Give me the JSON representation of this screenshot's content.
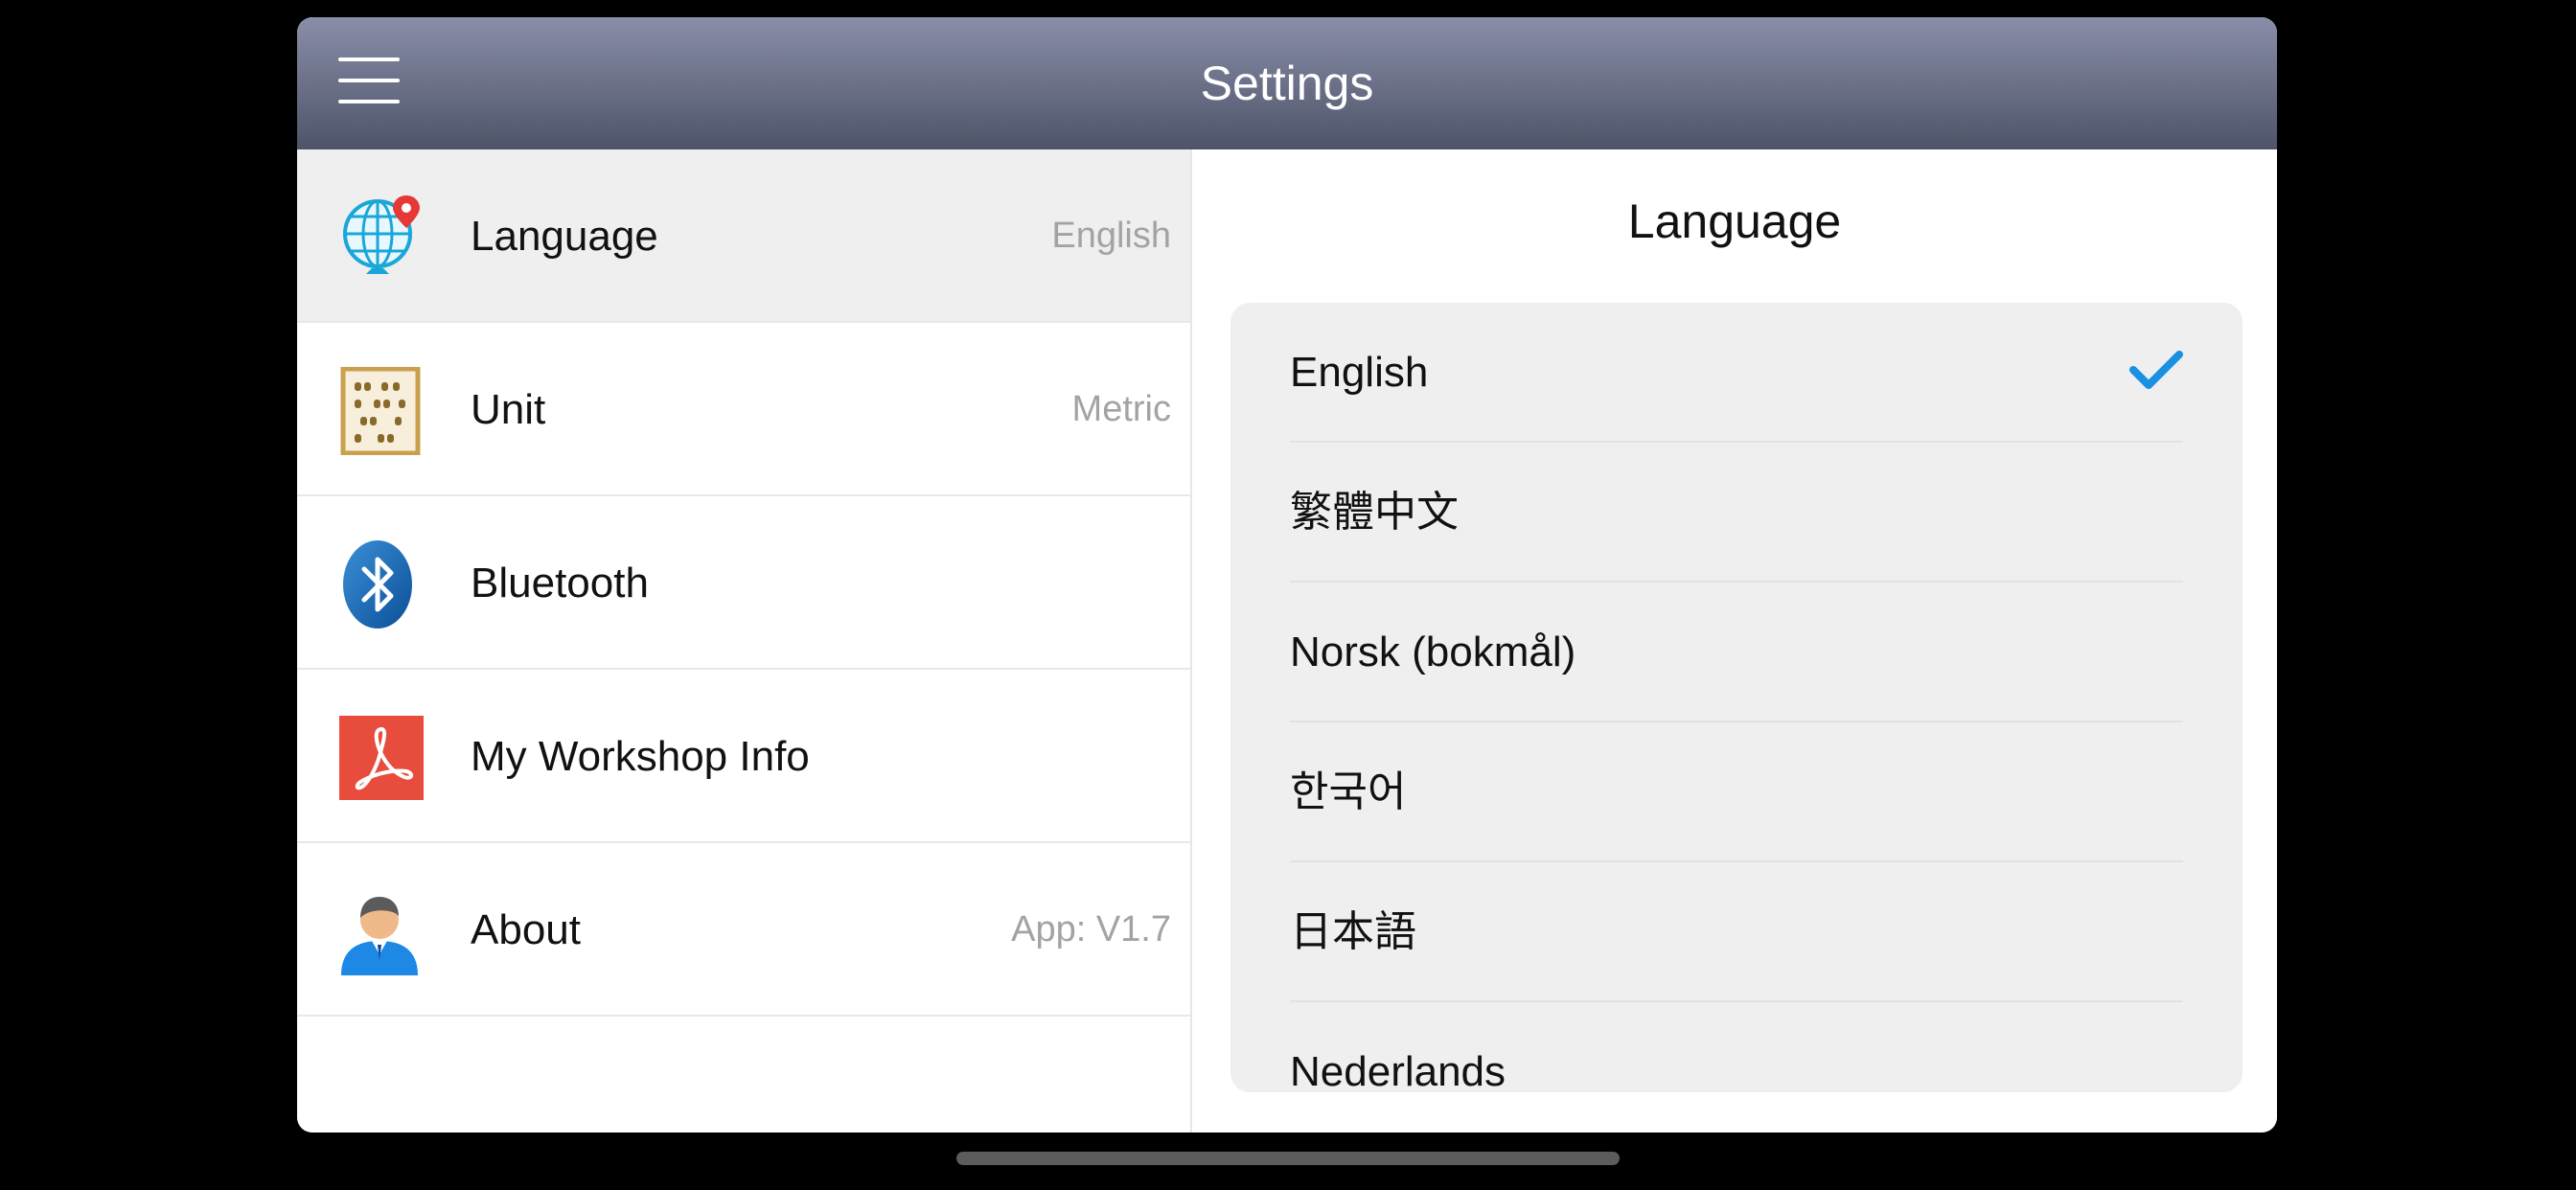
{
  "header": {
    "title": "Settings"
  },
  "sidebar": {
    "items": [
      {
        "label": "Language",
        "value": "English",
        "icon": "globe-location-icon",
        "selected": true
      },
      {
        "label": "Unit",
        "value": "Metric",
        "icon": "abacus-icon",
        "selected": false
      },
      {
        "label": "Bluetooth",
        "value": "",
        "icon": "bluetooth-icon",
        "selected": false
      },
      {
        "label": "My Workshop Info",
        "value": "",
        "icon": "pdf-document-icon",
        "selected": false
      },
      {
        "label": "About",
        "value": "App: V1.7",
        "icon": "user-avatar-icon",
        "selected": false
      }
    ]
  },
  "detail": {
    "title": "Language",
    "languages": [
      {
        "label": "English",
        "checked": true
      },
      {
        "label": "繁體中文",
        "checked": false
      },
      {
        "label": "Norsk (bokmål)",
        "checked": false
      },
      {
        "label": "한국어",
        "checked": false
      },
      {
        "label": "日本語",
        "checked": false
      },
      {
        "label": "Nederlands",
        "checked": false
      }
    ]
  },
  "colors": {
    "header_top": "#8a8ea9",
    "header_bottom": "#4d5468",
    "check": "#1a8fe3",
    "selected_row": "#efefef"
  }
}
